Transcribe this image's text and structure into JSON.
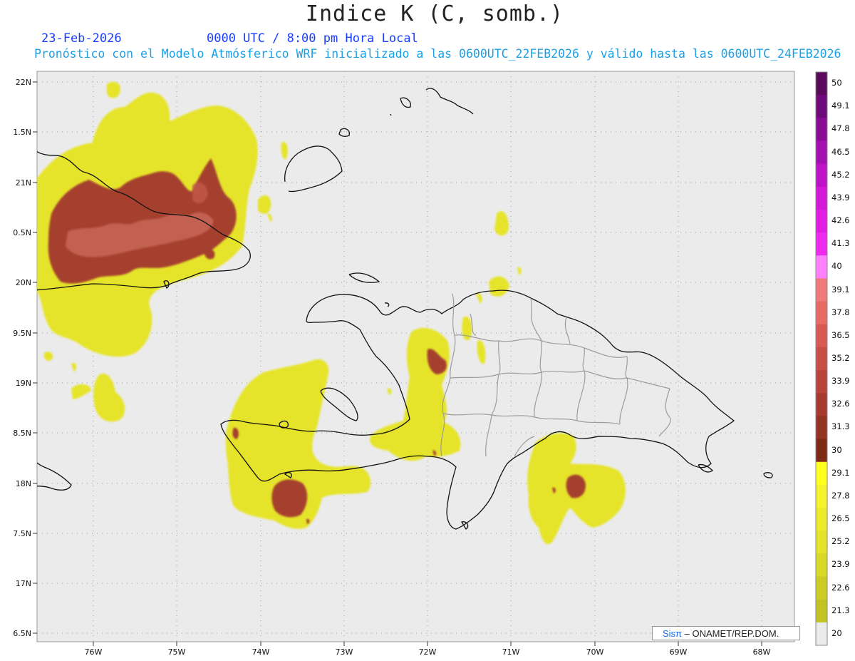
{
  "header": {
    "title": "Indice K (C, somb.)",
    "date": "23-Feb-2026",
    "valid_time": "0000 UTC / 8:00 pm Hora Local",
    "subtitle": "Pronóstico con el Modelo Atmósferico WRF inicializado a las 0600UTC_22FEB2026 y válido hasta las  0600UTC_24FEB2026"
  },
  "map": {
    "lat_labels": [
      "22N",
      "1.5N",
      "21N",
      "0.5N",
      "20N",
      "9.5N",
      "19N",
      "8.5N",
      "18N",
      "7.5N",
      "17N",
      "6.5N"
    ],
    "lon_labels": [
      "76W",
      "75W",
      "74W",
      "73W",
      "72W",
      "71W",
      "70W",
      "69W",
      "68W"
    ],
    "background_color": "#ebebeb",
    "grid": "dotted"
  },
  "colorbar": {
    "labels": [
      "50",
      "49.1",
      "47.8",
      "46.5",
      "45.2",
      "43.9",
      "42.6",
      "41.3",
      "40",
      "39.1",
      "37.8",
      "36.5",
      "35.2",
      "33.9",
      "32.6",
      "31.3",
      "30",
      "29.1",
      "27.8",
      "26.5",
      "25.2",
      "23.9",
      "22.6",
      "21.3",
      "20"
    ],
    "colors": [
      "#5a0a5a",
      "#6e0a7a",
      "#8a0c96",
      "#a40fb2",
      "#be12c8",
      "#d418d8",
      "#e21ee2",
      "#ee2aee",
      "#ff80ff",
      "#f07a7a",
      "#e86a64",
      "#d85a52",
      "#c84e46",
      "#b8443c",
      "#a63a30",
      "#943224",
      "#7e2a16",
      "#ffff20",
      "#f4f22a",
      "#ecea2a",
      "#e4e22a",
      "#d8d826",
      "#cccc24",
      "#c2c222",
      "#ebebeb"
    ]
  },
  "credit": {
    "brand": "Sisπ",
    "text": " – ONAMET/REP.DOM."
  }
}
